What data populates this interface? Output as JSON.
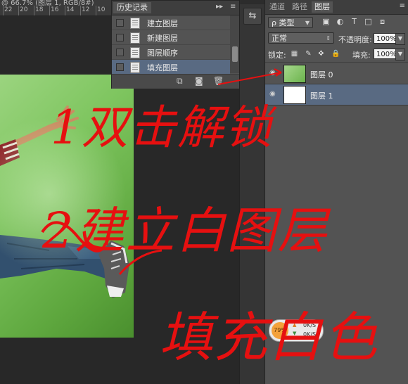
{
  "document": {
    "tab_title": "@ 66.7% (图层 1, RGB/8#)",
    "ruler_numbers": [
      "22",
      "20",
      "18",
      "16",
      "14",
      "12",
      "10"
    ]
  },
  "history_panel": {
    "tab_label": "历史记录",
    "collapse_glyph": "▸▸",
    "menu_glyph": "≡",
    "items": [
      {
        "label": "建立图层",
        "active": false
      },
      {
        "label": "新建图层",
        "active": false
      },
      {
        "label": "图层顺序",
        "active": false
      },
      {
        "label": "填充图层",
        "active": true
      }
    ],
    "footer_icons": [
      "new-document-icon",
      "camera-icon",
      "trash-icon"
    ],
    "footer_glyphs": [
      "⧉",
      "◙",
      "🗑"
    ]
  },
  "side_toolbar": {
    "tool_glyph": "⇆",
    "tool_icon": "history-brush-icon"
  },
  "layers_panel": {
    "tabs": [
      {
        "label": "通道",
        "active": false
      },
      {
        "label": "路径",
        "active": false
      },
      {
        "label": "图层",
        "active": true
      }
    ],
    "menu_glyph": "≡",
    "filter": {
      "selected": "类型",
      "kind_glyph": "ρ",
      "icons": [
        "image-filter-icon",
        "adjustment-filter-icon",
        "type-filter-icon",
        "shape-filter-icon",
        "smart-object-filter-icon"
      ],
      "glyphs": [
        "▣",
        "◐",
        "T",
        "□",
        "⧈"
      ]
    },
    "blend_mode": "正常",
    "opacity_label": "不透明度:",
    "opacity_value": "100%",
    "lock_label": "锁定:",
    "lock_icons": [
      "lock-transparent-icon",
      "lock-image-icon",
      "lock-position-icon",
      "lock-all-icon"
    ],
    "lock_glyphs": [
      "▦",
      "✎",
      "✥",
      "🔒"
    ],
    "fill_label": "填充:",
    "fill_value": "100%",
    "layers": [
      {
        "name": "图层 0",
        "thumb": "photo",
        "visible": true,
        "selected": false
      },
      {
        "name": "图层 1",
        "thumb": "white",
        "visible": true,
        "selected": true
      }
    ]
  },
  "speed_widget": {
    "percent": "79%",
    "upload": "0K/S",
    "download": "0K/S"
  },
  "annotations": [
    {
      "text": "1双击解锁"
    },
    {
      "text": "2建立白图层"
    },
    {
      "text": "填充白色"
    }
  ],
  "colors": {
    "annotation": "#e61010",
    "selection": "#596a82",
    "panel": "#535353"
  }
}
